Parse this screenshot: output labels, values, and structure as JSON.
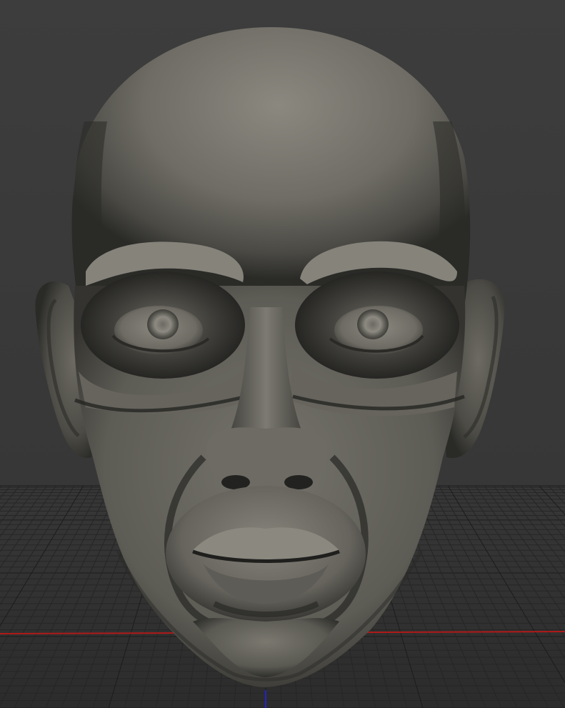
{
  "viewport": {
    "background": "#3b3b3b",
    "grid_color": "#262626",
    "grid_major_color": "#1c1c1c",
    "x_axis_color": "#b01919",
    "z_axis_color": "#2222cc"
  },
  "model": {
    "name": "sculpted-head",
    "base_color": "#78766e",
    "shadow_color": "#1e1e1c",
    "highlight_color": "#9a988f"
  }
}
